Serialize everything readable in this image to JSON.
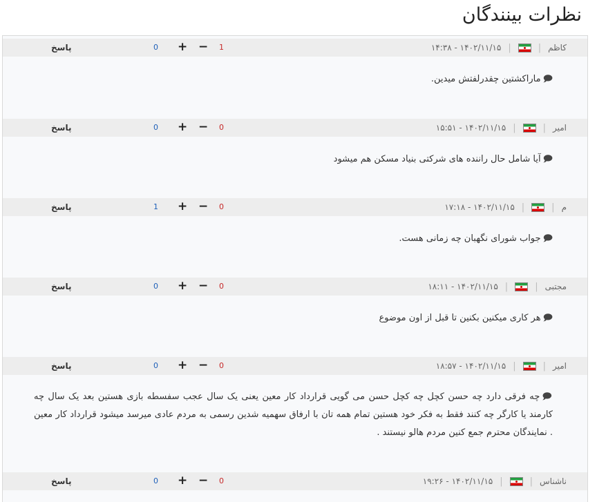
{
  "page": {
    "title": "نظرات بینندگان"
  },
  "labels": {
    "reply": "پاسخ",
    "plus": "+",
    "minus": "−",
    "separator": "|",
    "bubble_icon": "🗩"
  },
  "comments": [
    {
      "author": "کاظم",
      "date": "۱۴۰۲/۱۱/۱۵ - ۱۴:۳۸",
      "text": "ماراکشتین چقدرلفتش میدین.",
      "positive": "0",
      "negative": "1"
    },
    {
      "author": "امیر",
      "date": "۱۴۰۲/۱۱/۱۵ - ۱۵:۵۱",
      "text": "آیا شامل حال راننده های شرکتی بنیاد مسکن هم میشود",
      "positive": "0",
      "negative": "0"
    },
    {
      "author": "م",
      "date": "۱۴۰۲/۱۱/۱۵ - ۱۷:۱۸",
      "text": "جواب شورای نگهبان چه زمانی هست.",
      "positive": "1",
      "negative": "0"
    },
    {
      "author": "مجتبی",
      "date": "۱۴۰۲/۱۱/۱۵ - ۱۸:۱۱",
      "text": "هر کاری میکنین بکنین تا قبل از اون موضوع",
      "positive": "0",
      "negative": "0"
    },
    {
      "author": "امیر",
      "date": "۱۴۰۲/۱۱/۱۵ - ۱۸:۵۷",
      "text": "چه فرقی دارد چه حسن کچل چه کچل حسن می گویی قرارداد کار معین یعنی یک سال عجب سفسطه بازی هستین بعد یک سال چه کارمند یا کارگر چه کنند فقط به فکر خود هستین تمام همه تان با ارفاق سهمیه شدین رسمی به مردم عادی میرسد میشود قرارداد کار معین . نمایندگان محترم جمع کنین مردم هالو نیستند .",
      "positive": "0",
      "negative": "0"
    },
    {
      "author": "ناشناس",
      "date": "۱۴۰۲/۱۱/۱۵ - ۱۹:۲۶",
      "text": "",
      "positive": "0",
      "negative": "0"
    }
  ]
}
